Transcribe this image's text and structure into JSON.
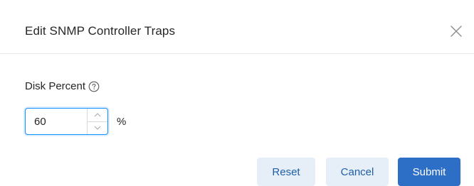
{
  "dialog": {
    "title": "Edit SNMP Controller Traps",
    "close_icon": "close-icon"
  },
  "field": {
    "label": "Disk Percent",
    "help_icon": "question-circle-icon",
    "value": "60",
    "unit": "%",
    "stepper_up_icon": "chevron-up-icon",
    "stepper_down_icon": "chevron-down-icon"
  },
  "footer": {
    "reset_label": "Reset",
    "cancel_label": "Cancel",
    "submit_label": "Submit"
  },
  "colors": {
    "accent": "#2d6fc6",
    "focus_border": "#1890ff",
    "secondary_button_bg": "#e6eef8"
  }
}
